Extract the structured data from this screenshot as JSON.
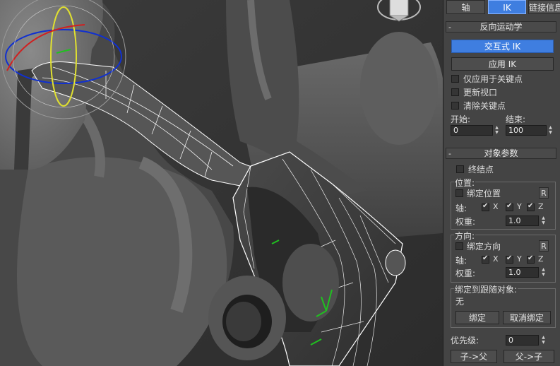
{
  "tabs": [
    {
      "label": "轴",
      "active": false
    },
    {
      "label": "IK",
      "active": true
    },
    {
      "label": "链接信息",
      "active": false
    }
  ],
  "ik_rollout": {
    "title": "反向运动学",
    "interactive_ik": "交互式 IK",
    "apply_ik": "应用 IK",
    "checkboxes": [
      {
        "label": "仅应用于关键点",
        "checked": false
      },
      {
        "label": "更新视口",
        "checked": false
      },
      {
        "label": "清除关键点",
        "checked": false
      }
    ],
    "start_label": "开始:",
    "end_label": "结束:",
    "start_value": "0",
    "end_value": "100"
  },
  "object_params": {
    "title": "对象参数",
    "terminator": {
      "label": "终结点",
      "checked": false
    },
    "position": {
      "group_label": "位置:",
      "bind_label": "绑定位置",
      "bind_checked": false,
      "r_button": "R",
      "axis_label": "轴:",
      "axes": [
        {
          "label": "X",
          "checked": true
        },
        {
          "label": "Y",
          "checked": true
        },
        {
          "label": "Z",
          "checked": true
        }
      ],
      "weight_label": "权重:",
      "weight_value": "1.0"
    },
    "orientation": {
      "group_label": "方向:",
      "bind_label": "绑定方向",
      "bind_checked": false,
      "r_button": "R",
      "axis_label": "轴:",
      "axes": [
        {
          "label": "X",
          "checked": true
        },
        {
          "label": "Y",
          "checked": true
        },
        {
          "label": "Z",
          "checked": true
        }
      ],
      "weight_label": "权重:",
      "weight_value": "1.0"
    },
    "follow": {
      "group_label": "绑定到跟随对象:",
      "none_text": "无",
      "bind_button": "绑定",
      "unbind_button": "取消绑定"
    },
    "priority_label": "优先级:",
    "priority_value": "0",
    "child_parent_button": "子->父",
    "parent_child_button": "父->子"
  },
  "viewport": {
    "background": "#3a3a3a",
    "selection_wire": "#ffffff",
    "gizmo_x": "#d02020",
    "gizmo_y": "#e0e030",
    "gizmo_z": "#1030d0",
    "pivot": "#20c020"
  }
}
